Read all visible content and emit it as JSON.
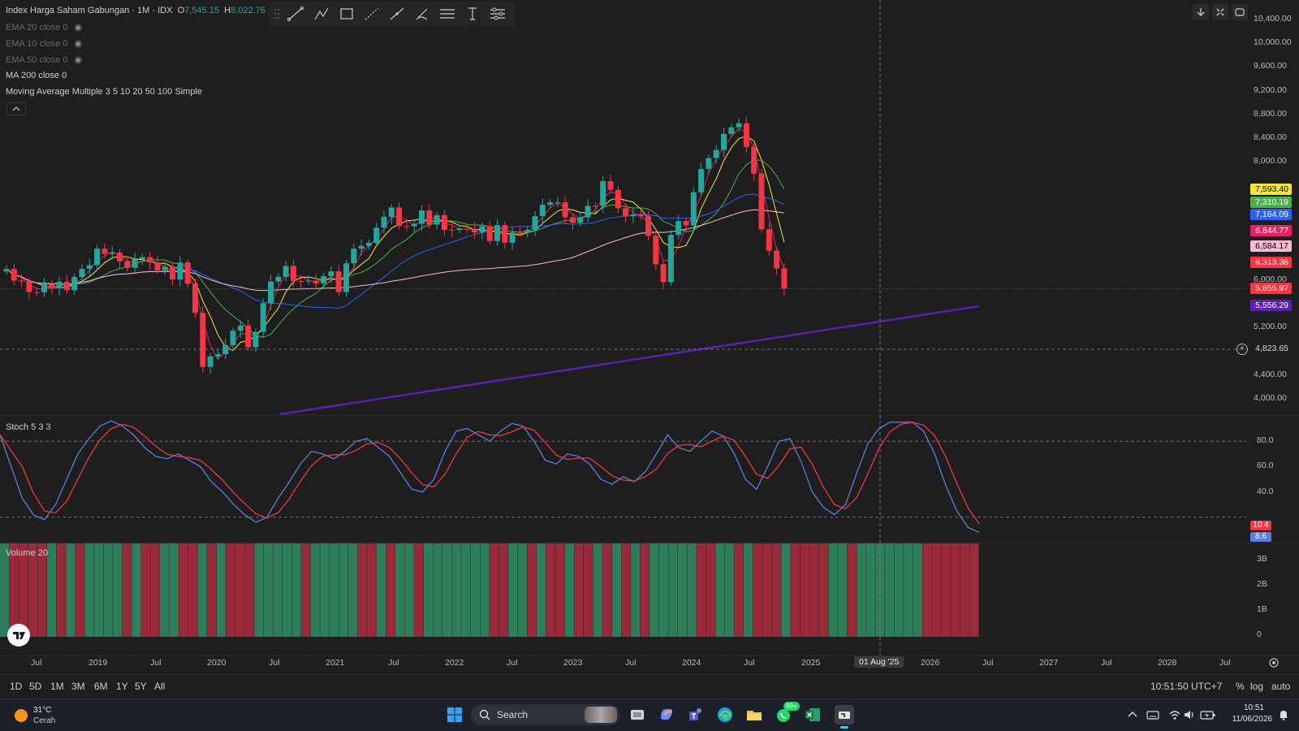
{
  "header": {
    "symbol_title": "Index Harga Saham Gabungan · 1M · IDX",
    "open_label": "O",
    "open_value": "7,545.15",
    "high_label": "H",
    "high_value": "8,022.76"
  },
  "indicators": [
    {
      "label": "EMA 20 close 0",
      "hidden": true
    },
    {
      "label": "EMA 10 close 0",
      "hidden": true
    },
    {
      "label": "EMA 50 close 0",
      "hidden": true
    },
    {
      "label": "MA 200 close 0",
      "hidden": false
    },
    {
      "label": "Moving Average Multiple 3 5 10 20 50 100 Simple",
      "hidden": false
    }
  ],
  "price_axis": {
    "ticks": [
      "10,400.00",
      "10,000.00",
      "9,600.00",
      "9,200.00",
      "8,800.00",
      "8,400.00",
      "8,000.00",
      "6,000.00",
      "5,200.00",
      "4,400.00",
      "4,000.00"
    ],
    "tick_values": [
      10400,
      10000,
      9600,
      9200,
      8800,
      8400,
      8000,
      6000,
      5200,
      4400,
      4000
    ],
    "crosshair_value": "4,823.65",
    "tags": [
      {
        "text": "7,593.40",
        "bg": "#f5e642",
        "fg": "#000000",
        "value": 7593.4
      },
      {
        "text": "7,310.19",
        "bg": "#4caf50",
        "fg": "#ffffff",
        "value": 7310.19
      },
      {
        "text": "7,164.09",
        "bg": "#2962ff",
        "fg": "#ffffff",
        "value": 7164.09
      },
      {
        "text": "6,844.77",
        "bg": "#e91e63",
        "fg": "#ffffff",
        "value": 6844.77
      },
      {
        "text": "6,584.17",
        "bg": "#f8bbd0",
        "fg": "#000000",
        "value": 6584.17
      },
      {
        "text": "6,313.38",
        "bg": "#f23645",
        "fg": "#ffffff",
        "value": 6313.38
      },
      {
        "text": "5,855.97",
        "bg": "#f23645",
        "fg": "#ffffff",
        "value": 5855.97
      },
      {
        "text": "5,556.29",
        "bg": "#5e1fb0",
        "fg": "#ffffff",
        "value": 5556.29
      }
    ]
  },
  "stoch": {
    "label": "Stoch 5 3 3",
    "ticks": [
      "80.0",
      "60.0",
      "40.0"
    ],
    "tick_values": [
      80,
      60,
      40
    ],
    "k_value": "10.4",
    "d_value": "8.6",
    "k_color": "#f23645",
    "d_color": "#5b7fe0"
  },
  "volume": {
    "label": "Volume 20",
    "ticks": [
      "3B",
      "2B",
      "1B",
      "0"
    ],
    "tick_values": [
      3,
      2,
      1,
      0
    ]
  },
  "time_axis": {
    "labels": [
      "Jul",
      "2019",
      "Jul",
      "2020",
      "Jul",
      "2021",
      "Jul",
      "2022",
      "Jul",
      "2023",
      "Jul",
      "2024",
      "Jul",
      "2025",
      "01 Aug '25",
      "2026",
      "Jul",
      "2027",
      "Jul",
      "2028",
      "Jul"
    ]
  },
  "timeframes": [
    "1D",
    "5D",
    "1M",
    "3M",
    "6M",
    "1Y",
    "5Y",
    "All"
  ],
  "bottom_right": {
    "clock": "10:51:50 UTC+7",
    "percent": "%",
    "log": "log",
    "auto": "auto"
  },
  "taskbar": {
    "weather_temp": "31°C",
    "weather_desc": "Cerah",
    "search_placeholder": "Search",
    "badge": "99+",
    "time": "10:51",
    "date": "11/06/2026"
  },
  "colors": {
    "up": "#26a69a",
    "down": "#f23645",
    "background": "#1e1e1e",
    "ma200": "#5e1fb0"
  }
}
